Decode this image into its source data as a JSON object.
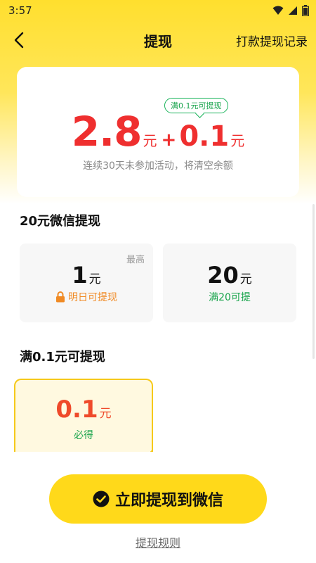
{
  "status_bar": {
    "time": "3:57"
  },
  "nav": {
    "title": "提现",
    "right_link": "打款提现记录"
  },
  "balance": {
    "tip_badge": "满0.1元可提现",
    "main_amount": "2.8",
    "main_unit": "元",
    "plus": "+",
    "bonus_amount": "0.1",
    "bonus_unit": "元",
    "subtitle": "连续30天未参加活动，将清空余额"
  },
  "wechat_section": {
    "title": "20元微信提现",
    "options": [
      {
        "corner": "最高",
        "amount": "1",
        "unit": "元",
        "note": "明日可提现",
        "note_color": "#f08a24"
      },
      {
        "amount": "20",
        "unit": "元",
        "note": "满20可提",
        "note_color": "#16a34a"
      }
    ]
  },
  "min_section": {
    "title": "满0.1元可提现",
    "option": {
      "amount": "0.1",
      "unit": "元",
      "note": "必得",
      "selected": true
    }
  },
  "actions": {
    "withdraw_button": "立即提现到微信",
    "rules_link": "提现规则"
  },
  "colors": {
    "accent": "#ffd91a",
    "amount_red": "#ef2f2f",
    "green": "#16a34a",
    "orange": "#f08a24"
  }
}
